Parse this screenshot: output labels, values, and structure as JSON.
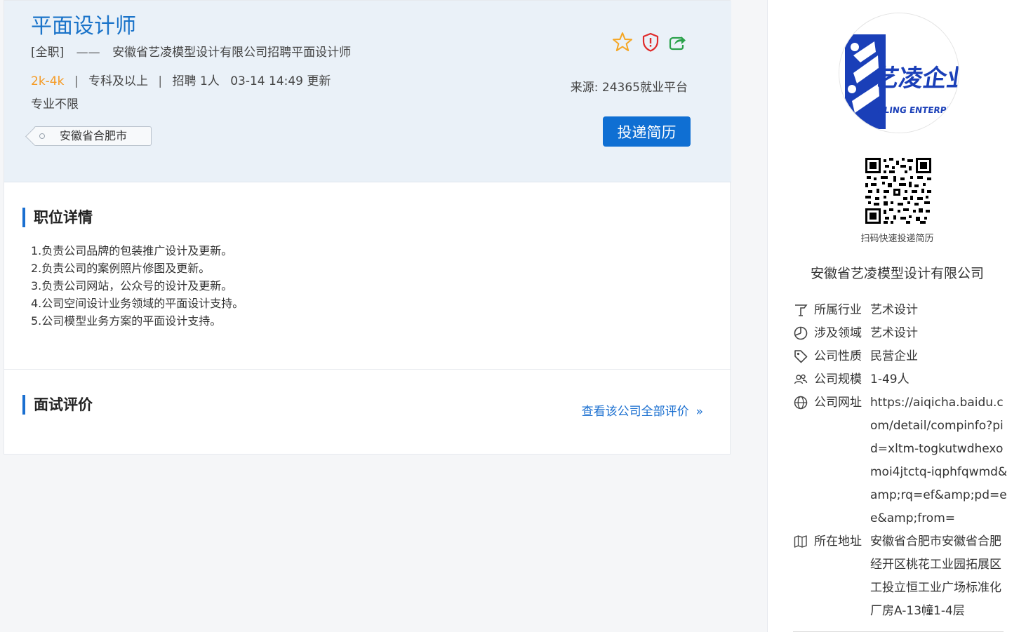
{
  "job": {
    "title": "平面设计师",
    "type": "[全职]",
    "dash": "——",
    "subtitle": "安徽省艺凌模型设计有限公司招聘平面设计师",
    "salary": "2k-4k",
    "sep": "|",
    "education": "专科及以上",
    "headcount": "招聘 1人",
    "updated": "03-14 14:49 更新",
    "major": "专业不限",
    "location": "安徽省合肥市",
    "source": "来源:  24365就业平台",
    "apply_label": "投递简历",
    "icons": [
      "star-icon",
      "report-shield-icon",
      "share-icon"
    ],
    "colors": {
      "accent": "#1a73c9",
      "salary": "#f59a23",
      "button": "#0f6fd3",
      "report": "#e02b2b",
      "share": "#2aa14a"
    }
  },
  "details": {
    "heading": "职位详情",
    "duties": [
      "1.负责公司品牌的包装推广设计及更新。",
      "2.负责公司的案例照片修图及更新。",
      "3.负责公司网站，公众号的设计及更新。",
      "4.公司空间设计业务领域的平面设计支持。",
      "5.公司模型业务方案的平面设计支持。"
    ]
  },
  "review": {
    "heading": "面试评价",
    "link_label": "查看该公司全部评价",
    "chevron": "»"
  },
  "company": {
    "logo_text": "艺凌企业",
    "logo_sub": "YILING ENTERPRISE",
    "qr_caption": "扫码快速投递简历",
    "name": "安徽省艺凌模型设计有限公司",
    "info": [
      {
        "icon": "industry-icon",
        "label": "所属行业",
        "value": "艺术设计"
      },
      {
        "icon": "domain-pie-icon",
        "label": "涉及领域",
        "value": "艺术设计"
      },
      {
        "icon": "tag-icon",
        "label": "公司性质",
        "value": "民营企业"
      },
      {
        "icon": "people-icon",
        "label": "公司规模",
        "value": "1-49人"
      },
      {
        "icon": "globe-icon",
        "label": "公司网址",
        "value": "https://aiqicha.baidu.com/detail/compinfo?pid=xltm-togkutwdhexomoi4jtctq-iqphfqwmd&amp;rq=ef&amp;pd=ee&amp;from="
      },
      {
        "icon": "map-icon",
        "label": "所在地址",
        "value": "安徽省合肥市安徽省合肥经开区桃花工业园拓展区工投立恒工业广场标准化厂房A-13幢1-4层"
      }
    ]
  }
}
